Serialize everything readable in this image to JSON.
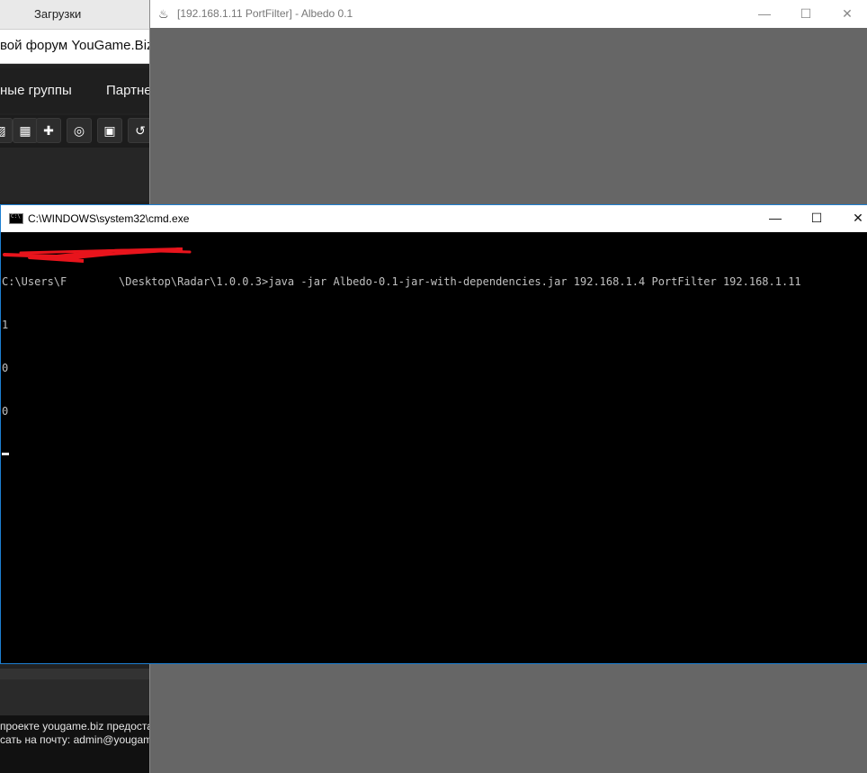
{
  "browser": {
    "tab_label": "Загрузки",
    "url_fragment": "вой форум YouGame.Biz",
    "nav_items": [
      "ные группы",
      "Партне"
    ],
    "toolbar_icons": [
      "image-icon",
      "film-icon",
      "plus-icon",
      "eye-off-icon",
      "save-icon",
      "undo-icon"
    ],
    "footer_lines": [
      "проекте yougame.biz предостав",
      "сать на почту: admin@yougame"
    ]
  },
  "albedo": {
    "title": "[192.168.1.11 PortFilter] - Albedo 0.1",
    "controls": [
      "—",
      "☐",
      "✕"
    ]
  },
  "cmd": {
    "title": "C:\\WINDOWS\\system32\\cmd.exe",
    "prompt_visible": "C:\\Users\\F        \\Desktop\\Radar\\1.0.0.3>",
    "command": "java -jar Albedo-0.1-jar-with-dependencies.jar 192.168.1.4 PortFilter 192.168.1.11",
    "output_lines": [
      "1",
      "0",
      "0"
    ],
    "controls": [
      "—",
      "☐",
      "✕"
    ]
  },
  "colors": {
    "cmd_border": "#1d7fd1",
    "albedo_bg": "#666666",
    "redaction": "#e8141c"
  }
}
